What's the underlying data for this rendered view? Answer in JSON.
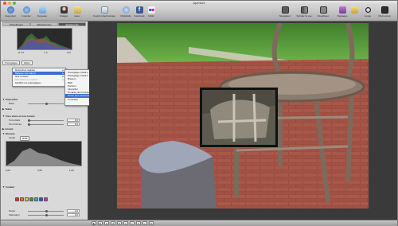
{
  "window": {
    "title": "Aperture"
  },
  "toolbar": {
    "items": [
      {
        "label": "Inspecteur",
        "icon": "info-icon"
      },
      {
        "label": "Importer",
        "icon": "import-icon"
      },
      {
        "label": "Nouveau",
        "icon": "new-icon"
      },
      {
        "label": "Visages",
        "icon": "faces-icon"
      },
      {
        "label": "Lieux",
        "icon": "places-icon"
      },
      {
        "label": "Courrier électronique",
        "icon": "mail-icon"
      },
      {
        "label": "MobileMe",
        "icon": "mobileme-icon"
      },
      {
        "label": "Facebook",
        "icon": "facebook-icon"
      },
      {
        "label": "Flickr",
        "icon": "flickr-icon"
      },
      {
        "label": "Navigateur",
        "icon": "browser-icon"
      },
      {
        "label": "Scinder la vue",
        "icon": "split-view-icon"
      },
      {
        "label": "Visualiseur",
        "icon": "viewer-icon"
      },
      {
        "label": "Réglages",
        "icon": "adjustments-icon"
      },
      {
        "label": "Loupe",
        "icon": "loupe-icon"
      },
      {
        "label": "Plein écran",
        "icon": "fullscreen-icon"
      }
    ]
  },
  "inspector": {
    "tabs": [
      "Photothèque",
      "Métadonnées",
      "Ajustements"
    ],
    "active_tab": "Ajustements",
    "histogram_readout": [
      "R 0 0",
      "V 0",
      "B 0"
    ],
    "preset_button": "Préréglages",
    "effects_button": "Effets",
    "reset_button": "Remettre",
    "sections": {
      "white_balance": "Balance des blancs",
      "noir_blanc": "Noir et blanc",
      "monochrome": "Monochrome couleur",
      "modify_presets": "Modifier les préréglages...",
      "exposure": "Exposition",
      "exposure_value": "0,0",
      "clarity_label": "Éclat",
      "clarity_value": "0,0",
      "tone": "Teinte",
      "shadows_highlights": "Tons clairs et tons foncés",
      "highlights_label": "Tons clairs",
      "highlights_value": "0,0",
      "shadows_label": "Tons foncés",
      "shadows_value": "0,0",
      "sharpen": "Accent",
      "levels": "Niveaux",
      "channel_label": "Canal",
      "channel_value": "RVB",
      "levels_min": "0,00",
      "levels_mid": "0,50",
      "levels_max": "1,00",
      "color": "Couleur",
      "hue_label": "Teinte",
      "hue_value": "0,0",
      "saturation_label": "Saturation",
      "saturation_value": "0,0",
      "luminance_label": "Luminance",
      "luminance_value": "0,0",
      "range_label": "Gamme",
      "range_value": "1,0"
    },
    "swatch_colors": [
      "#e03030",
      "#e07a1a",
      "#e0d020",
      "#30a030",
      "#2ab0c0",
      "#3050d0",
      "#c030c0"
    ]
  },
  "presets_menu": {
    "items": [
      {
        "label": "Retouches rapides",
        "submenu": true
      },
      {
        "label": "Balance des blancs",
        "submenu": true,
        "active": true
      },
      {
        "label": "Noir et blanc",
        "submenu": true
      },
      {
        "label": "Monochrome couleur",
        "submenu": true,
        "disabled": true
      },
      {
        "label": "Modifier les préréglages...",
        "submenu": false
      }
    ]
  },
  "submenu": {
    "items": [
      {
        "label": "Préréglage cristal 1"
      },
      {
        "label": "Préréglage cristal 2"
      },
      {
        "label": "Brasero"
      },
      {
        "label": "Bâtir"
      },
      {
        "label": "Perforer"
      },
      {
        "label": "Intensifier"
      },
      {
        "label": "Tonalité plus lumineuse faible"
      },
      {
        "label": "Teinte plus lumineuse (fort)",
        "selected": true
      },
      {
        "label": "Contraste"
      }
    ]
  },
  "bottom_tools": [
    "▶",
    "⊕",
    "⊖",
    "↺",
    "↻",
    "✂",
    "⌖",
    "✎",
    "◐",
    "⟲"
  ]
}
